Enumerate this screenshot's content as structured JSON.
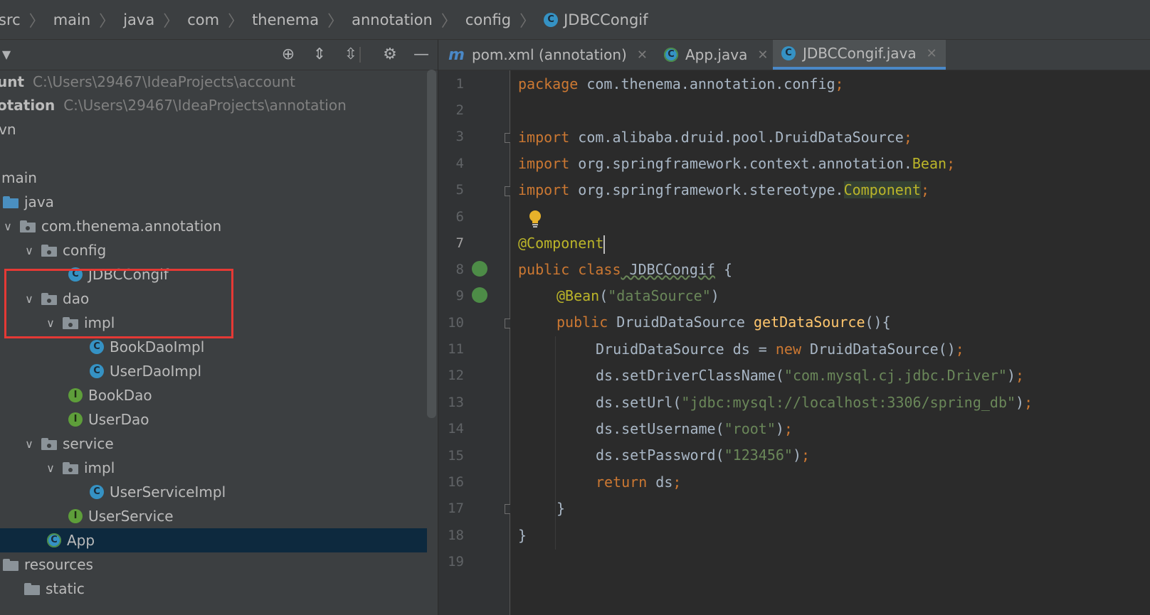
{
  "breadcrumb": {
    "items": [
      "src",
      "main",
      "java",
      "com",
      "thenema",
      "annotation",
      "config"
    ],
    "file": "JDBCCongif",
    "file_icon": "class-icon"
  },
  "project_toolbar": {
    "icons": [
      "locate-icon",
      "expand-all-icon",
      "collapse-all-icon",
      "gear-icon",
      "minimize-icon"
    ]
  },
  "tree": {
    "rows": [
      {
        "label": "unt",
        "path": "C:\\Users\\29467\\IdeaProjects\\account"
      },
      {
        "label": "otation",
        "path": "C:\\Users\\29467\\IdeaProjects\\annotation"
      },
      {
        "label": "vn"
      },
      {
        "label": "main"
      },
      {
        "label": "java"
      },
      {
        "label": "com.thenema.annotation"
      },
      {
        "label": "config"
      },
      {
        "label": "JDBCCongif"
      },
      {
        "label": "dao"
      },
      {
        "label": "impl"
      },
      {
        "label": "BookDaoImpl"
      },
      {
        "label": "UserDaoImpl"
      },
      {
        "label": "BookDao"
      },
      {
        "label": "UserDao"
      },
      {
        "label": "service"
      },
      {
        "label": "impl"
      },
      {
        "label": "UserServiceImpl"
      },
      {
        "label": "UserService"
      },
      {
        "label": "App"
      },
      {
        "label": "resources"
      },
      {
        "label": "static"
      }
    ],
    "selected": "App"
  },
  "tabs": [
    {
      "label": "pom.xml (annotation)",
      "icon": "maven-icon"
    },
    {
      "label": "App.java",
      "icon": "runnable-class-icon"
    },
    {
      "label": "JDBCCongif.java",
      "icon": "class-icon",
      "active": true
    }
  ],
  "icon_letters": {
    "class": "C",
    "interface": "I",
    "maven": "m",
    "close": "✕"
  },
  "editor": {
    "current_line": 7,
    "line_numbers": [
      "1",
      "2",
      "3",
      "4",
      "5",
      "6",
      "7",
      "8",
      "9",
      "10",
      "11",
      "12",
      "13",
      "14",
      "15",
      "16",
      "17",
      "18",
      "19"
    ],
    "code": {
      "l1_kw": "package",
      "l1_rest": " com.thenema.annotation.config",
      "l1_semi": ";",
      "l3_kw": "import",
      "l3_rest": " com.alibaba.druid.pool.DruidDataSource",
      "l3_semi": ";",
      "l4_kw": "import",
      "l4_rest": " org.springframework.context.annotation.",
      "l4_ann": "Bean",
      "l4_semi": ";",
      "l5_kw": "import",
      "l5_rest": " org.springframework.stereotype.",
      "l5_ann": "Component",
      "l5_semi": ";",
      "l7_ann": "@Component",
      "l8_kw": "public class",
      "l8_name": " JDBCCongif",
      "l8_rest": " {",
      "l9_ann": "@Bean",
      "l9_open": "(",
      "l9_str": "\"dataSource\"",
      "l9_close": ")",
      "l10_kw": "public",
      "l10_type": " DruidDataSource ",
      "l10_fn": "getDataSource",
      "l10_rest": "(){",
      "l11_a": "DruidDataSource ds = ",
      "l11_kw": "new",
      "l11_b": " DruidDataSource()",
      "l11_semi": ";",
      "l12_a": "ds.setDriverClassName(",
      "l12_str": "\"com.mysql.cj.jdbc.Driver\"",
      "l12_b": ")",
      "l12_semi": ";",
      "l13_a": "ds.setUrl(",
      "l13_str": "\"jdbc:mysql://localhost:3306/spring_db\"",
      "l13_b": ")",
      "l13_semi": ";",
      "l14_a": "ds.setUsername(",
      "l14_str": "\"root\"",
      "l14_b": ")",
      "l14_semi": ";",
      "l15_a": "ds.setPassword(",
      "l15_str": "\"123456\"",
      "l15_b": ")",
      "l15_semi": ";",
      "l16_kw": "return",
      "l16_rest": " ds",
      "l16_semi": ";",
      "l17": "}",
      "l18": "}"
    }
  },
  "colors": {
    "keyword": "#cc7832",
    "annotation": "#bbb529",
    "string": "#6a8759",
    "method": "#ffc66d",
    "text": "#a9b7c6",
    "selection": "#0d293e",
    "highlight_box": "#e53935",
    "accent": "#4a88c7"
  }
}
